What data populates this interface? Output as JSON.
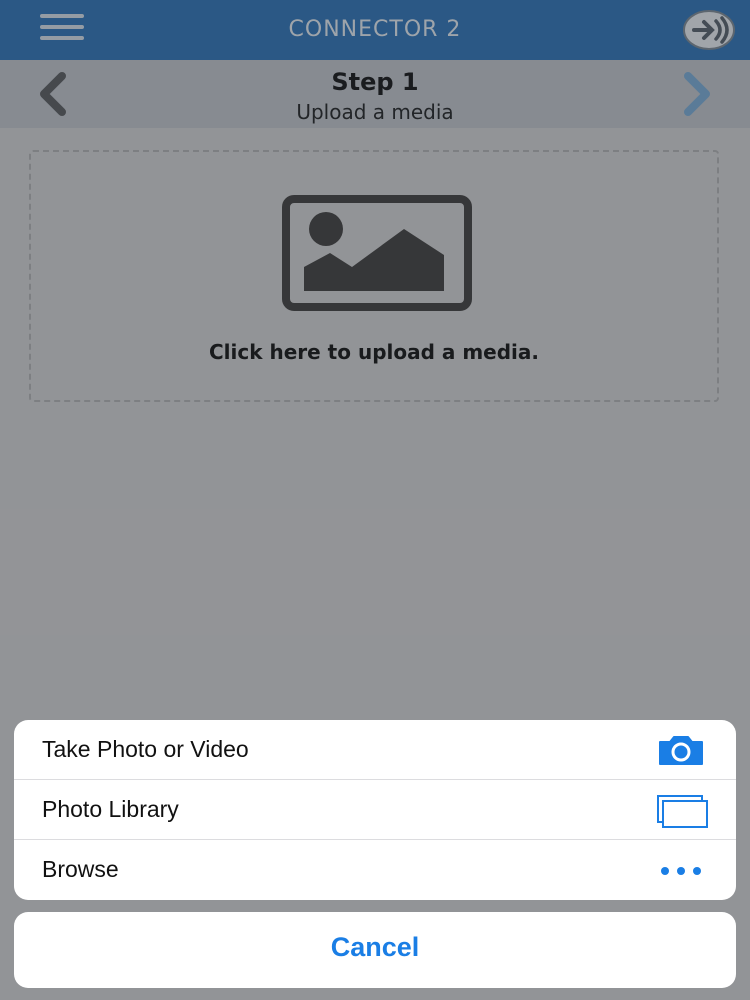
{
  "header": {
    "title": "CONNECTOR 2",
    "menu_icon": "hamburger-menu-icon",
    "logo_icon": "connector-logo-icon"
  },
  "step": {
    "title": "Step 1",
    "subtitle": "Upload a media",
    "prev_icon": "chevron-left-icon",
    "next_icon": "chevron-right-icon"
  },
  "upload": {
    "icon": "image-placeholder-icon",
    "label": "Click here to upload a media."
  },
  "action_sheet": {
    "items": [
      {
        "label": "Take Photo or Video",
        "icon": "camera-icon"
      },
      {
        "label": "Photo Library",
        "icon": "photo-library-icon"
      },
      {
        "label": "Browse",
        "icon": "more-dots-icon"
      }
    ],
    "cancel_label": "Cancel"
  },
  "colors": {
    "header_bg": "#3a77b4",
    "accent_blue": "#1a7ee5",
    "step_bar_bg": "#b7bcc4"
  }
}
